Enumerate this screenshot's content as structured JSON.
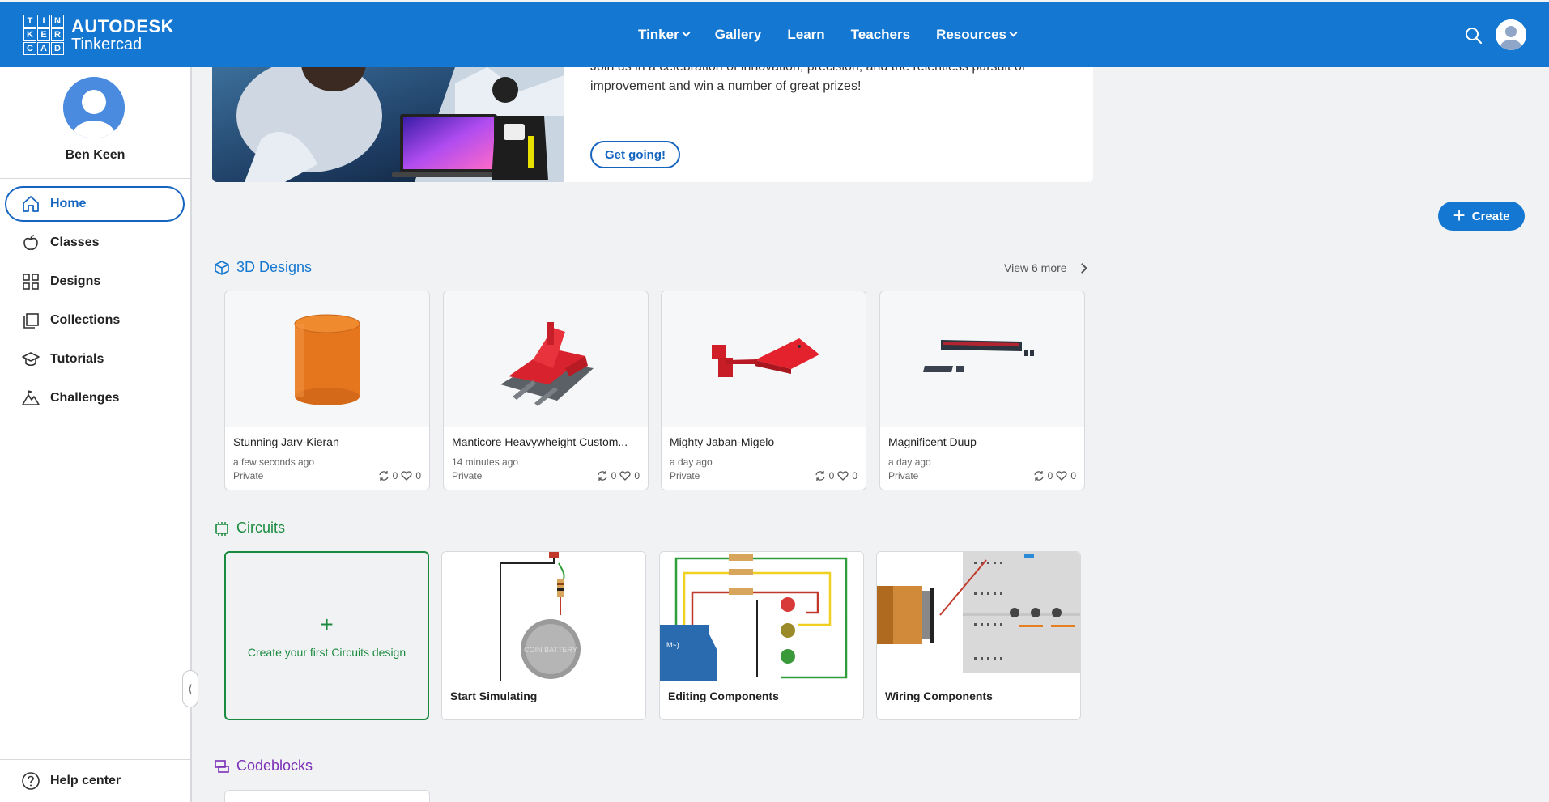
{
  "header": {
    "logo_letters": [
      "TIN",
      "KER",
      "CAD"
    ],
    "brand": "AUTODESK",
    "product": "Tinkercad",
    "nav": [
      {
        "label": "Tinker",
        "dropdown": true
      },
      {
        "label": "Gallery",
        "dropdown": false
      },
      {
        "label": "Learn",
        "dropdown": false
      },
      {
        "label": "Teachers",
        "dropdown": false
      },
      {
        "label": "Resources",
        "dropdown": true
      }
    ],
    "accent_color": "#1477d1"
  },
  "sidebar": {
    "user_name": "Ben Keen",
    "items": [
      {
        "label": "Home",
        "icon": "home-icon",
        "active": true
      },
      {
        "label": "Classes",
        "icon": "apple-icon"
      },
      {
        "label": "Designs",
        "icon": "grid-icon"
      },
      {
        "label": "Collections",
        "icon": "collections-icon"
      },
      {
        "label": "Tutorials",
        "icon": "graduation-cap-icon"
      },
      {
        "label": "Challenges",
        "icon": "mountain-icon"
      }
    ],
    "help_label": "Help center"
  },
  "banner": {
    "text": "Join us in a celebration of innovation, precision, and the relentless pursuit of improvement and win a number of great prizes!",
    "button_label": "Get going!"
  },
  "create_button": "Create",
  "designs": {
    "heading": "3D Designs",
    "view_more": "View 6 more",
    "heading_color": "#1477d1",
    "cards": [
      {
        "title": "Stunning Jarv-Kieran",
        "time": "a few seconds ago",
        "visibility": "Private",
        "remixes": "0",
        "likes": "0"
      },
      {
        "title": "Manticore Heavywheight Custom...",
        "time": "14 minutes ago",
        "visibility": "Private",
        "remixes": "0",
        "likes": "0"
      },
      {
        "title": "Mighty Jaban-Migelo",
        "time": "a day ago",
        "visibility": "Private",
        "remixes": "0",
        "likes": "0"
      },
      {
        "title": "Magnificent Duup",
        "time": "a day ago",
        "visibility": "Private",
        "remixes": "0",
        "likes": "0"
      }
    ]
  },
  "circuits": {
    "heading": "Circuits",
    "heading_color": "#1a8a3f",
    "create_first": "Create your first Circuits design",
    "tutorials": [
      {
        "title": "Start Simulating"
      },
      {
        "title": "Editing Components"
      },
      {
        "title": "Wiring Components"
      }
    ]
  },
  "codeblocks": {
    "heading": "Codeblocks",
    "heading_color": "#7b2fb7"
  }
}
